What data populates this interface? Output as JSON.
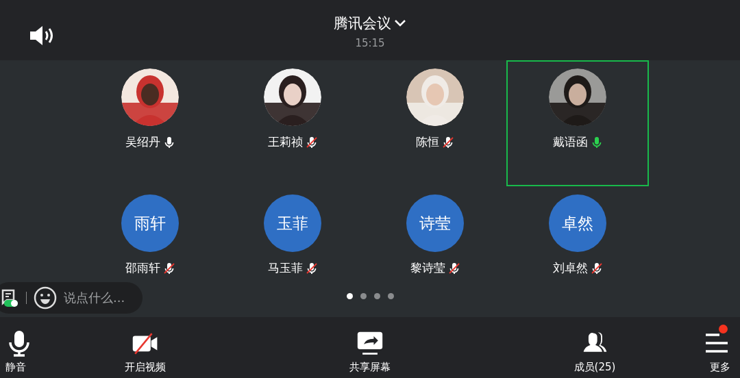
{
  "header": {
    "title": "腾讯会议",
    "time": "15:15"
  },
  "participants": [
    {
      "name": "吴绍丹",
      "muted": false,
      "speaking": false,
      "highlighted": false
    },
    {
      "name": "王莉祯",
      "muted": true,
      "speaking": false,
      "highlighted": false
    },
    {
      "name": "陈恒",
      "muted": true,
      "speaking": false,
      "highlighted": false
    },
    {
      "name": "戴语函",
      "muted": false,
      "speaking": true,
      "highlighted": true
    },
    {
      "name": "邵雨轩",
      "avatar_text": "雨轩",
      "muted": true,
      "speaking": false,
      "highlighted": false
    },
    {
      "name": "马玉菲",
      "avatar_text": "玉菲",
      "muted": true,
      "speaking": false,
      "highlighted": false
    },
    {
      "name": "黎诗莹",
      "avatar_text": "诗莹",
      "muted": true,
      "speaking": false,
      "highlighted": false
    },
    {
      "name": "刘卓然",
      "avatar_text": "卓然",
      "muted": true,
      "speaking": false,
      "highlighted": false
    }
  ],
  "pages": [
    {
      "selected": true
    },
    {
      "selected": false
    },
    {
      "selected": false
    },
    {
      "selected": false
    }
  ],
  "chat": {
    "placeholder": "说点什么...",
    "enabled": true
  },
  "toolbar": [
    {
      "kind": "mic",
      "label": "静音"
    },
    {
      "kind": "video",
      "label": "开启视频"
    },
    {
      "kind": "share",
      "label": "共享屏幕"
    },
    {
      "kind": "members",
      "label": "成员(25)"
    },
    {
      "kind": "more",
      "label": "更多",
      "badge": true
    }
  ]
}
